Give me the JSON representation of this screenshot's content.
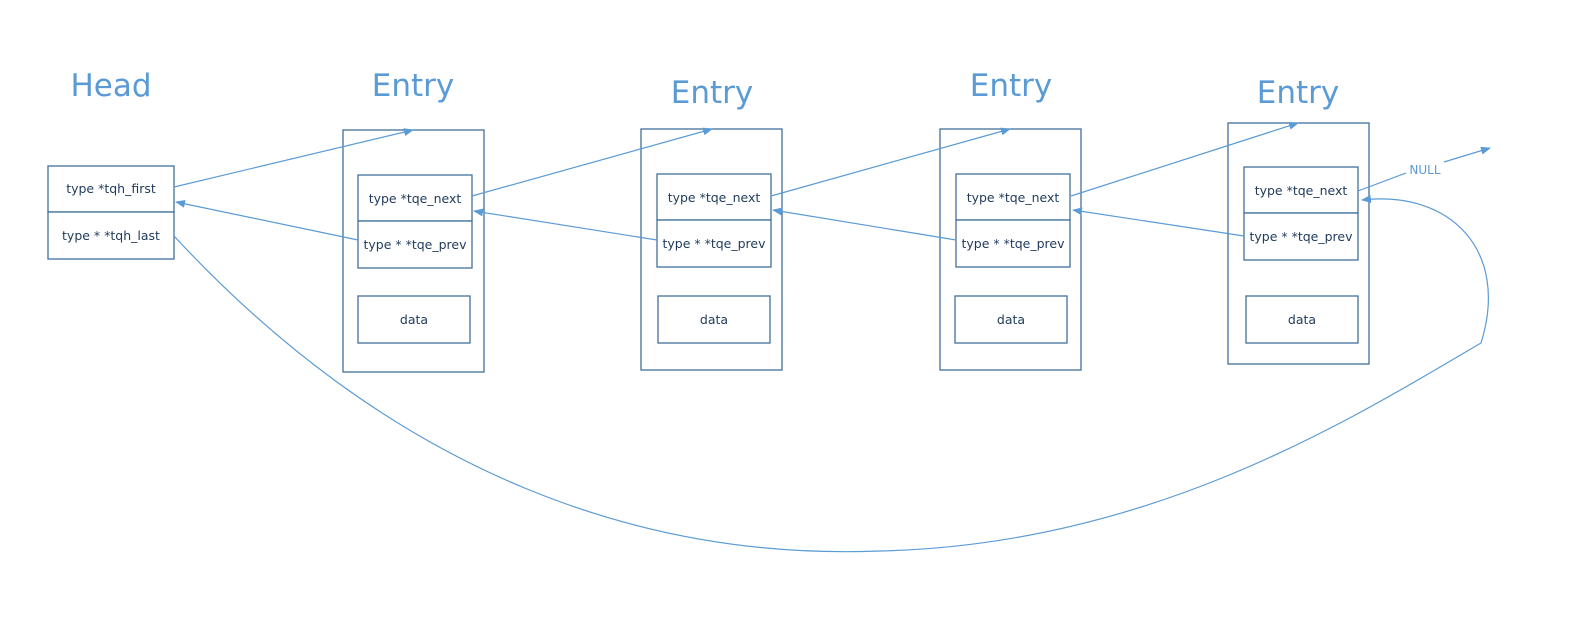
{
  "head": {
    "title": "Head",
    "first": "type *tqh_first",
    "last": "type * *tqh_last"
  },
  "entries": [
    {
      "title": "Entry",
      "next": "type *tqe_next",
      "prev": "type * *tqe_prev",
      "data": "data"
    },
    {
      "title": "Entry",
      "next": "type *tqe_next",
      "prev": "type * *tqe_prev",
      "data": "data"
    },
    {
      "title": "Entry",
      "next": "type *tqe_next",
      "prev": "type * *tqe_prev",
      "data": "data"
    },
    {
      "title": "Entry",
      "next": "type *tqe_next",
      "prev": "type * *tqe_prev",
      "data": "data"
    }
  ],
  "null_label": "NULL",
  "colors": {
    "line": "#5b9bd5",
    "border": "#41719c",
    "title": "#5b9bd5"
  }
}
